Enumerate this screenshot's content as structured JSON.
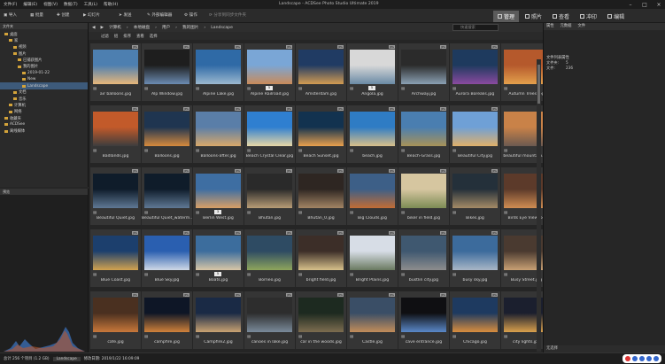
{
  "window": {
    "title": "Landscape - ACDSee Photo Studio Ultimate 2019",
    "menu": [
      "文件(F)",
      "编辑(E)",
      "视图(V)",
      "数据(T)",
      "工具(L)",
      "帮助(H)"
    ]
  },
  "toolbar": {
    "import": "导入",
    "batch": "批量",
    "create": "创建",
    "slideshow": "幻灯片",
    "send": "发送",
    "external_editor": "外部编辑器",
    "actions": "操作",
    "search_sync": "分享到同步文件夹"
  },
  "modes": [
    {
      "label": "管理",
      "active": true,
      "icon": "manage-icon"
    },
    {
      "label": "照片",
      "active": false,
      "icon": "photos-icon"
    },
    {
      "label": "查看",
      "active": false,
      "icon": "view-icon"
    },
    {
      "label": "冲印",
      "active": false,
      "icon": "develop-icon"
    },
    {
      "label": "编辑",
      "active": false,
      "icon": "edit-icon"
    }
  ],
  "left_panel": {
    "title": "文件夹",
    "tree": [
      {
        "label": "桌面",
        "indent": 1,
        "selected": false
      },
      {
        "label": "家",
        "indent": 2,
        "selected": false
      },
      {
        "label": "视频",
        "indent": 3,
        "selected": false
      },
      {
        "label": "图片",
        "indent": 3,
        "selected": false
      },
      {
        "label": "已捕获图片",
        "indent": 4,
        "selected": false
      },
      {
        "label": "我的图片",
        "indent": 4,
        "selected": false
      },
      {
        "label": "2019-01-22",
        "indent": 5,
        "selected": false
      },
      {
        "label": "New",
        "indent": 5,
        "selected": false
      },
      {
        "label": "Landscape",
        "indent": 5,
        "selected": true
      },
      {
        "label": "文档",
        "indent": 3,
        "selected": false
      },
      {
        "label": "音乐",
        "indent": 3,
        "selected": false
      },
      {
        "label": "计算机",
        "indent": 2,
        "selected": false
      },
      {
        "label": "网络",
        "indent": 2,
        "selected": false
      },
      {
        "label": "收藏夹",
        "indent": 1,
        "selected": false
      },
      {
        "label": "ACDSee",
        "indent": 1,
        "selected": false
      },
      {
        "label": "离线媒体",
        "indent": 1,
        "selected": false
      }
    ]
  },
  "preview_panel": {
    "title": "预览"
  },
  "address": {
    "breadcrumbs": [
      "计算机",
      "本地磁盘",
      "用户",
      "我的图片",
      "Landscape"
    ],
    "search_placeholder": "快速搜索",
    "filter_bar": [
      "过滤",
      "组",
      "排序",
      "查看",
      "选择"
    ]
  },
  "thumbnails": [
    {
      "name": "air balloons.jpg",
      "colors": [
        "#4d7fb0",
        "#e7b77a"
      ],
      "num": ""
    },
    {
      "name": "Alp Window.jpg",
      "colors": [
        "#1e1e1e",
        "#6b8bb2"
      ],
      "num": ""
    },
    {
      "name": "Alpine Lake.jpg",
      "colors": [
        "#2f6aa6",
        "#9bb8cf"
      ],
      "num": ""
    },
    {
      "name": "Alpine Railroad.jpg",
      "colors": [
        "#7aa6d6",
        "#c98b5a"
      ],
      "num": "5"
    },
    {
      "name": "Amsterdam.jpg",
      "colors": [
        "#203b63",
        "#d29b52"
      ],
      "num": ""
    },
    {
      "name": "Angola.jpg",
      "colors": [
        "#d8d8d8",
        "#6a8aa5"
      ],
      "num": "5"
    },
    {
      "name": "Archway.jpg",
      "colors": [
        "#2b2b2b",
        "#8aa0b3"
      ],
      "num": ""
    },
    {
      "name": "Aurora Borealis.jpg",
      "colors": [
        "#1e3a5e",
        "#8a4aa0"
      ],
      "num": ""
    },
    {
      "name": "Autumn Trees.jpg",
      "colors": [
        "#b5592c",
        "#e3a04c"
      ],
      "num": ""
    },
    {
      "name": "Badlands.jpg",
      "colors": [
        "#c25a2a",
        "#3d3d3d"
      ],
      "num": ""
    },
    {
      "name": "Balloons.jpg",
      "colors": [
        "#1f3550",
        "#d68a3d"
      ],
      "num": ""
    },
    {
      "name": "Balloons-after.jpg",
      "colors": [
        "#5a7ea8",
        "#d8a86a"
      ],
      "num": ""
    },
    {
      "name": "Beach Crystal Clear.jpg",
      "colors": [
        "#2f7fd0",
        "#e7d7a6"
      ],
      "num": ""
    },
    {
      "name": "Beach Sunset.jpg",
      "colors": [
        "#12324f",
        "#e9a04d"
      ],
      "num": ""
    },
    {
      "name": "beach.jpg",
      "colors": [
        "#2f7cc4",
        "#d9c08a"
      ],
      "num": ""
    },
    {
      "name": "Beach-Grass.jpg",
      "colors": [
        "#4a7eb0",
        "#a89258"
      ],
      "num": ""
    },
    {
      "name": "Beautiful City.jpg",
      "colors": [
        "#6fa0d6",
        "#e0b06a"
      ],
      "num": ""
    },
    {
      "name": "beautiful mountain.jpg",
      "colors": [
        "#c98248",
        "#6c5a50"
      ],
      "num": ""
    },
    {
      "name": "Beautiful Quiet.jpg",
      "colors": [
        "#0f1c2a",
        "#5f7894"
      ],
      "num": ""
    },
    {
      "name": "Beautiful Quiet_waterm...",
      "colors": [
        "#0f1c2a",
        "#5f7894"
      ],
      "num": ""
    },
    {
      "name": "Berlin West.jpg",
      "colors": [
        "#3e6ea2",
        "#d89f66"
      ],
      "num": "3"
    },
    {
      "name": "Bhutan.jpg",
      "colors": [
        "#2a2a2a",
        "#b89c76"
      ],
      "num": ""
    },
    {
      "name": "Bhutan_0.jpg",
      "colors": [
        "#2e2622",
        "#a28464"
      ],
      "num": ""
    },
    {
      "name": "Big Clouds.jpg",
      "colors": [
        "#3d5f87",
        "#c26c35"
      ],
      "num": ""
    },
    {
      "name": "biker in field.jpg",
      "colors": [
        "#d6c6a0",
        "#7d8c55"
      ],
      "num": ""
    },
    {
      "name": "Bikes.jpg",
      "colors": [
        "#24303a",
        "#a48a66"
      ],
      "num": ""
    },
    {
      "name": "Birds Eye View.jpg",
      "colors": [
        "#5c3a2a",
        "#d08d52"
      ],
      "num": ""
    },
    {
      "name": "Blue Coast.jpg",
      "colors": [
        "#1c3f6d",
        "#d2a24f"
      ],
      "num": ""
    },
    {
      "name": "Blue Sky.jpg",
      "colors": [
        "#2a5fb0",
        "#cfd8e6"
      ],
      "num": ""
    },
    {
      "name": "Boats.jpg",
      "colors": [
        "#3c6d9d",
        "#d8c6a6"
      ],
      "num": "5"
    },
    {
      "name": "Borneo.jpg",
      "colors": [
        "#2e4b63",
        "#8ea55c"
      ],
      "num": ""
    },
    {
      "name": "bright field.jpg",
      "colors": [
        "#3c2e28",
        "#d7c08a"
      ],
      "num": ""
    },
    {
      "name": "Bright Plains.jpg",
      "colors": [
        "#d7dde6",
        "#6a7a60"
      ],
      "num": ""
    },
    {
      "name": "bustlin city.jpg",
      "colors": [
        "#3f5870",
        "#8d8d8d"
      ],
      "num": ""
    },
    {
      "name": "busy sky.jpg",
      "colors": [
        "#3c6b9c",
        "#a8b6c6"
      ],
      "num": ""
    },
    {
      "name": "Busy Street.jpg",
      "colors": [
        "#4a3a30",
        "#c9a074"
      ],
      "num": ""
    },
    {
      "name": "cafe.jpg",
      "colors": [
        "#4a3020",
        "#c8783a"
      ],
      "num": ""
    },
    {
      "name": "campfire.jpg",
      "colors": [
        "#0e1626",
        "#d0813a"
      ],
      "num": ""
    },
    {
      "name": "Campfire2.jpg",
      "colors": [
        "#1a2a45",
        "#c9a272"
      ],
      "num": ""
    },
    {
      "name": "canoes in lake.jpg",
      "colors": [
        "#2d2d2d",
        "#7a8a9a"
      ],
      "num": ""
    },
    {
      "name": "car in the woods.jpg",
      "colors": [
        "#1d2a20",
        "#7d6d50"
      ],
      "num": ""
    },
    {
      "name": "Castle.jpg",
      "colors": [
        "#3a4e66",
        "#c28d5a"
      ],
      "num": ""
    },
    {
      "name": "cave entrance.jpg",
      "colors": [
        "#0f0f12",
        "#5a88c8"
      ],
      "num": ""
    },
    {
      "name": "Chicago.jpg",
      "colors": [
        "#1e3a60",
        "#d88d3e"
      ],
      "num": ""
    },
    {
      "name": "city lights.jpg",
      "colors": [
        "#1b1f2e",
        "#d9a04c"
      ],
      "num": ""
    }
  ],
  "right_panel": {
    "tabs": [
      "属性",
      "元数据",
      "文件"
    ],
    "section": "文件列表属性",
    "rows": [
      {
        "key": "文件夹:",
        "value": "5"
      },
      {
        "key": "文件:",
        "value": "236"
      }
    ],
    "bottom_label": "无选择"
  },
  "status": {
    "total": "总计 256 个项目 (1.2 GB)",
    "folder": "Landscape",
    "modified": "修改日期: 2019/1/22 16:09:09"
  }
}
